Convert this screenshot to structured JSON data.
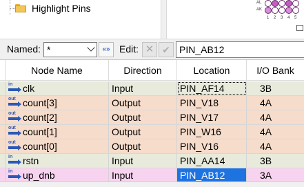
{
  "tree": {
    "highlight_label": "Highlight Pins"
  },
  "pin_planner": {
    "row_labels": [
      "AL",
      "AK"
    ],
    "col_numbers": [
      "1",
      "2",
      "3",
      "4",
      "5"
    ]
  },
  "filter": {
    "named_label": "Named:",
    "named_value": "*",
    "edit_label": "Edit:",
    "edit_value": "PIN_AB12"
  },
  "table": {
    "headers": {
      "node": "Node Name",
      "direction": "Direction",
      "location": "Location",
      "bank": "I/O Bank"
    },
    "rows": [
      {
        "dir_icon": "in",
        "node": "clk",
        "direction": "Input",
        "location": "PIN_AF14",
        "bank": "3B"
      },
      {
        "dir_icon": "out",
        "node": "count[3]",
        "direction": "Output",
        "location": "PIN_V18",
        "bank": "4A"
      },
      {
        "dir_icon": "out",
        "node": "count[2]",
        "direction": "Output",
        "location": "PIN_V17",
        "bank": "4A"
      },
      {
        "dir_icon": "out",
        "node": "count[1]",
        "direction": "Output",
        "location": "PIN_W16",
        "bank": "4A"
      },
      {
        "dir_icon": "out",
        "node": "count[0]",
        "direction": "Output",
        "location": "PIN_V16",
        "bank": "4A"
      },
      {
        "dir_icon": "in",
        "node": "rstn",
        "direction": "Input",
        "location": "PIN_AA14",
        "bank": "3B"
      },
      {
        "dir_icon": "in",
        "node": "up_dnb",
        "direction": "Input",
        "location": "PIN_AB12",
        "bank": "3A"
      }
    ]
  },
  "colors": {
    "input_row": "#e8ebdc",
    "output_row": "#f6dccb",
    "selected_row": "#f7d3ef",
    "selected_cell": "#1f73e0",
    "icon_blue": "#2a58b8",
    "pin_purple": "#6a2b6a"
  },
  "icons": {
    "folder": "folder-icon",
    "wildcard": "wildcard-icon",
    "cancel": "cancel-x-icon",
    "accept": "checkmark-icon",
    "input_pin": "input-pin-icon",
    "output_pin": "output-pin-icon"
  }
}
